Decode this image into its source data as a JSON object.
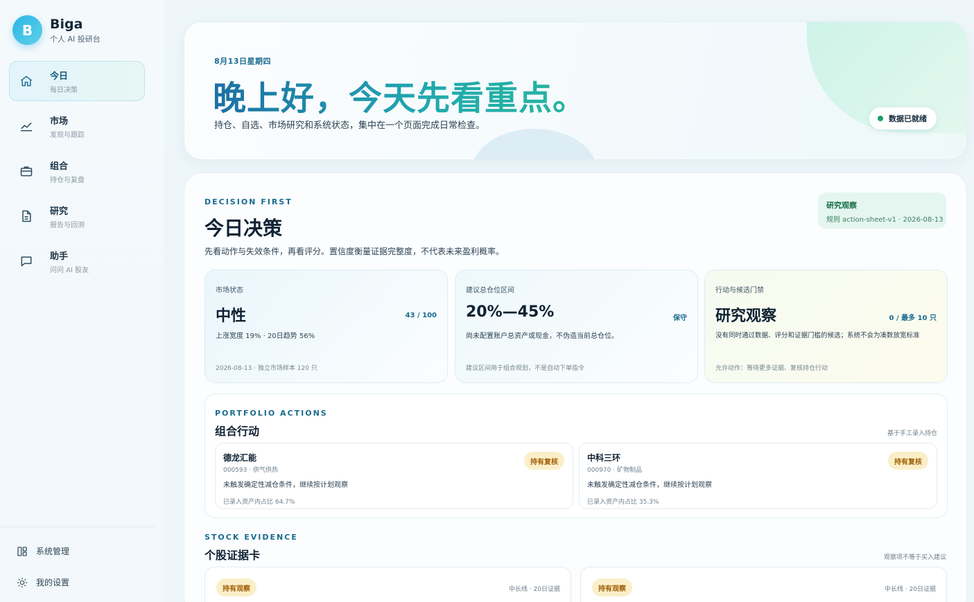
{
  "brand": {
    "logo": "B",
    "name": "Biga",
    "subtitle": "个人 AI 投研台"
  },
  "nav": [
    {
      "label": "今日",
      "sub": "每日决策",
      "icon": "home-icon"
    },
    {
      "label": "市场",
      "sub": "发现与跟踪",
      "icon": "chart-trend-icon"
    },
    {
      "label": "组合",
      "sub": "持仓与复盘",
      "icon": "briefcase-icon"
    },
    {
      "label": "研究",
      "sub": "报告与回测",
      "icon": "document-icon"
    },
    {
      "label": "助手",
      "sub": "问问 AI 股友",
      "icon": "chat-icon"
    }
  ],
  "bottom_nav": {
    "system": "系统管理",
    "settings": "我的设置"
  },
  "hero": {
    "date": "8月13日星期四",
    "title": "晚上好，今天先看重点。",
    "desc": "持仓、自选、市场研究和系统状态，集中在一个页面完成日常检查。",
    "status": "数据已就绪",
    "status_color": "#18a067"
  },
  "decision": {
    "eyebrow": "DECISION FIRST",
    "title": "今日决策",
    "desc": "先看动作与失效条件，再看评分。置信度衡量证据完整度，不代表未来盈利概率。",
    "rule_title": "研究观察",
    "rule_sub": "规则 action-sheet-v1 · 2026-08-13"
  },
  "kpis": [
    {
      "label": "市场状态",
      "value": "中性",
      "tag": "43 / 100",
      "desc": "上涨宽度 19% · 20日趋势 56%",
      "foot": "2026-08-13 · 独立市场样本 120 只"
    },
    {
      "label": "建议总仓位区间",
      "value": "20%—45%",
      "tag": "保守",
      "desc": "尚未配置账户总资产或现金，不伪造当前总仓位。",
      "foot": "建议区间用于组合规划，不是自动下单指令"
    },
    {
      "label": "行动与候选门禁",
      "value": "研究观察",
      "tag": "0 / 最多 10 只",
      "desc": "没有同时通过数据、评分和证据门槛的候选；系统不会为凑数放宽标准",
      "foot": "允许动作：等待更多证据、复核持仓行动"
    }
  ],
  "portfolio": {
    "eyebrow": "PORTFOLIO ACTIONS",
    "title": "组合行动",
    "note": "基于手工录入持仓",
    "holdings": [
      {
        "name": "德龙汇能",
        "code": "000593 · 供气供热",
        "badge": "持有复核",
        "desc": "未触发确定性减仓条件，继续按计划观察",
        "foot": "已录入资产内占比 64.7%"
      },
      {
        "name": "中科三环",
        "code": "000970 · 矿物制品",
        "badge": "持有复核",
        "desc": "未触发确定性减仓条件，继续按计划观察",
        "foot": "已录入资产内占比 35.3%"
      }
    ]
  },
  "evidence": {
    "eyebrow": "STOCK EVIDENCE",
    "title": "个股证据卡",
    "note": "观察项不等于买入建议",
    "cards": [
      {
        "badge": "持有观察",
        "meta": "中长线 · 20日证据"
      },
      {
        "badge": "持有观察",
        "meta": "中长线 · 20日证据"
      }
    ]
  }
}
